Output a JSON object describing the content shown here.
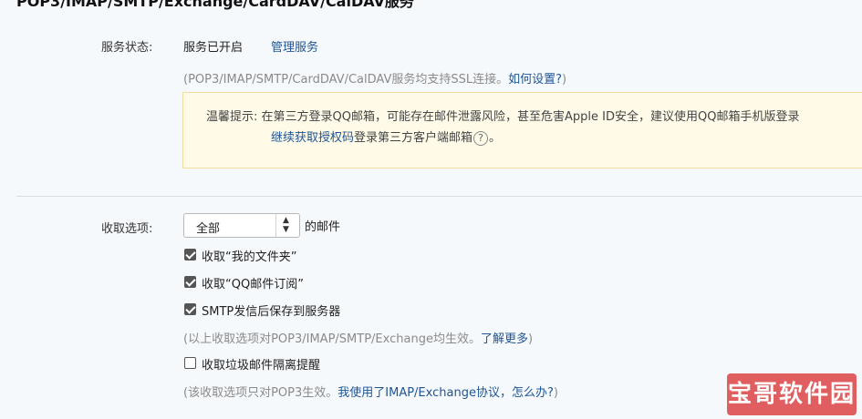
{
  "section_title": "POP3/IMAP/SMTP/Exchange/CardDAV/CalDAV服务",
  "service": {
    "status_label": "服务状态:",
    "status_value": "服务已开启",
    "manage_link": "管理服务",
    "ssl_note": "(POP3/IMAP/SMTP/CardDAV/CalDAV服务均支持SSL连接。",
    "ssl_link": "如何设置?",
    "ssl_note_end": ")"
  },
  "tip": {
    "prefix": "温馨提示:",
    "line1": "在第三方登录QQ邮箱，可能存在邮件泄露风险，甚至危害Apple ID安全，建议使用QQ邮箱手机版登录",
    "line2_link": "继续获取授权码",
    "line2_text": "登录第三方客户端邮箱",
    "line2_end": "。",
    "help_icon": "question-circle-icon"
  },
  "receive": {
    "label": "收取选项:",
    "select_value": "全部",
    "select_suffix": "的邮件",
    "options": [
      {
        "label": "收取“我的文件夹”",
        "checked": true
      },
      {
        "label": "收取“QQ邮件订阅”",
        "checked": true
      },
      {
        "label": "SMTP发信后保存到服务器",
        "checked": true
      }
    ],
    "note1": "(以上收取选项对POP3/IMAP/SMTP/Exchange均生效。",
    "note1_link": "了解更多",
    "note1_end": ")",
    "spam_option": {
      "label": "收取垃圾邮件隔离提醒",
      "checked": false
    },
    "note2": "(该收取选项只对POP3生效。",
    "note2_link": "我使用了IMAP/Exchange协议，怎么办?",
    "note2_end": ")"
  },
  "watermark": "宝哥软件园"
}
